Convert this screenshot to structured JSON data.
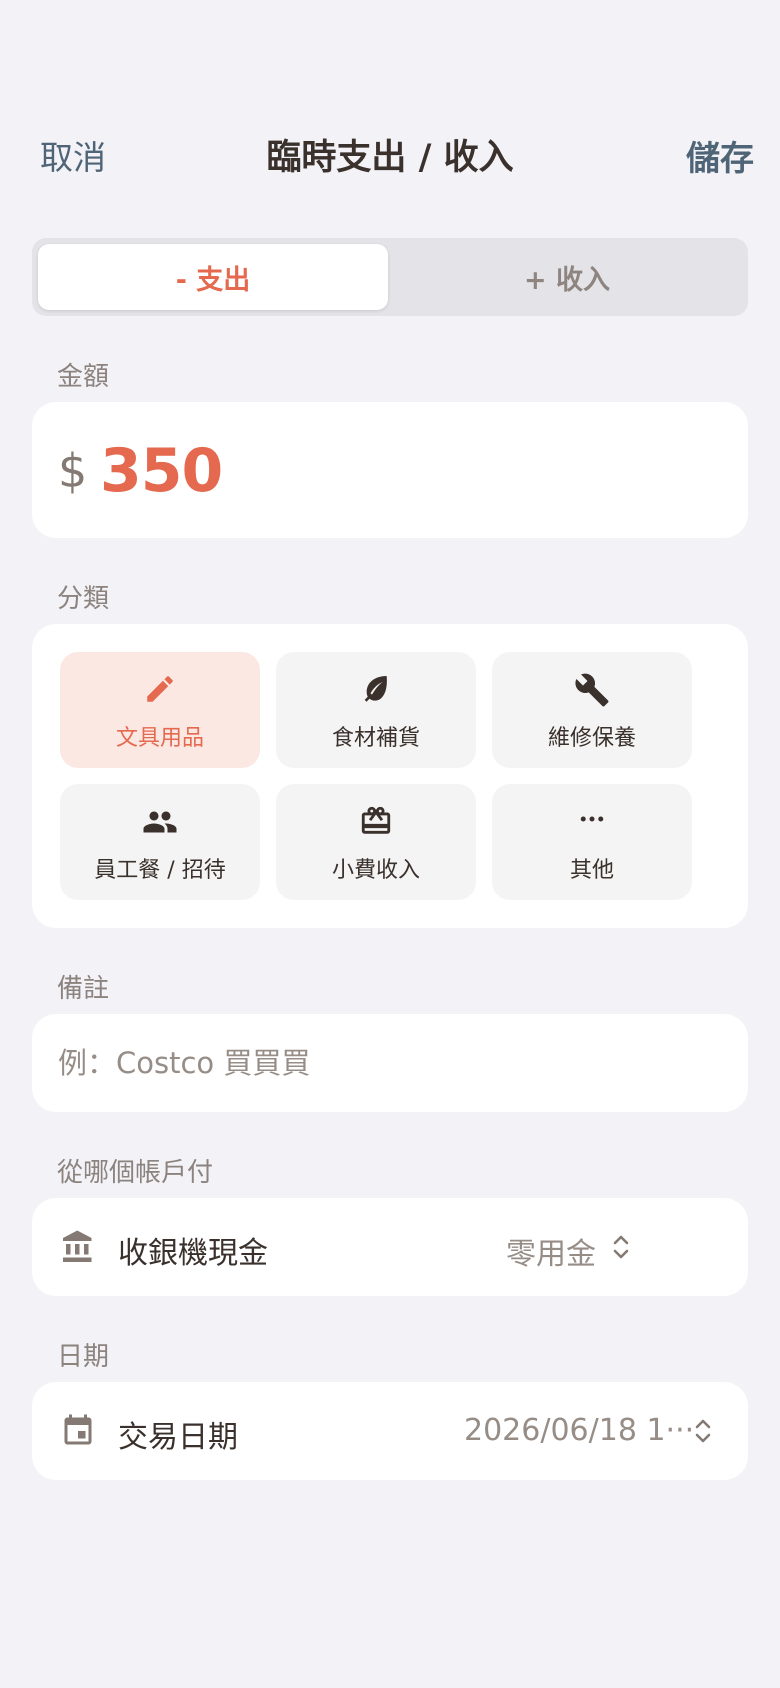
{
  "nav": {
    "cancel": "取消",
    "title": "臨時支出 / 收入",
    "save": "儲存"
  },
  "type_toggle": {
    "expense": "- 支出",
    "income": "+ 收入",
    "selected": "expense"
  },
  "amount": {
    "label": "金額",
    "currency": "$",
    "value": "350"
  },
  "category": {
    "label": "分類",
    "items": [
      {
        "label": "文具用品",
        "icon": "pencil-icon",
        "selected": true
      },
      {
        "label": "食材補貨",
        "icon": "leaf-icon",
        "selected": false
      },
      {
        "label": "維修保養",
        "icon": "wrench-icon",
        "selected": false
      },
      {
        "label": "員工餐 / 招待",
        "icon": "people-icon",
        "selected": false
      },
      {
        "label": "小費收入",
        "icon": "gift-card-icon",
        "selected": false
      },
      {
        "label": "其他",
        "icon": "more-horizontal-icon",
        "selected": false
      }
    ]
  },
  "note": {
    "label": "備註",
    "placeholder": "例：Costco 買買買",
    "value": ""
  },
  "account": {
    "label": "從哪個帳戶付",
    "title": "收銀機現金",
    "value": "零用金",
    "icon": "bank-icon"
  },
  "date": {
    "label": "日期",
    "title": "交易日期",
    "value": "2026/06/18 1···",
    "icon": "calendar-icon"
  },
  "colors": {
    "accent": "#e4694f",
    "nav_action": "#4f6577",
    "selected_bg": "#fce8e3",
    "text": "#3a312c",
    "muted": "#8c837e"
  }
}
